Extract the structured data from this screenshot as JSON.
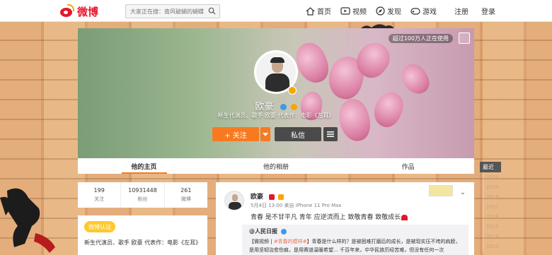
{
  "header": {
    "logo_text": "微博",
    "search_placeholder": "大家正在搜：南风破蝴的蝴蝶目...",
    "nav": [
      {
        "label": "首页",
        "icon": "home-icon"
      },
      {
        "label": "视频",
        "icon": "video-icon"
      },
      {
        "label": "发现",
        "icon": "discover-icon"
      },
      {
        "label": "游戏",
        "icon": "game-icon"
      }
    ],
    "register_label": "注册",
    "login_label": "登录"
  },
  "profile": {
    "cover_badge": "超过100万人正在使用",
    "name": "欧豪",
    "bio": "新生代演员、歌手 欧豪 代表作：电影《左耳》",
    "follow_label": "+ 关注",
    "message_label": "私信"
  },
  "tabs": [
    {
      "label": "他的主页",
      "active": true
    },
    {
      "label": "他的相册",
      "active": false
    },
    {
      "label": "作品",
      "active": false
    }
  ],
  "timeline": {
    "head": "最近",
    "years": [
      "2020",
      "2019",
      "2018",
      "2017",
      "2016",
      "2015",
      "2014",
      "2013"
    ]
  },
  "stats": [
    {
      "value": "199",
      "label": "关注"
    },
    {
      "value": "10931448",
      "label": "粉丝"
    },
    {
      "value": "261",
      "label": "微博"
    }
  ],
  "info": {
    "badge": "微博认证",
    "text": "新生代演员、歌手 欧豪 代表作：电影《左耳》"
  },
  "post": {
    "author": "欧豪",
    "meta": "5月4日 13:00 来自 iPhone 11 Pro Max",
    "text": "青春 是不甘平凡 青年 应逆流而上 致敬青春 致敬成长",
    "repost_author": "@人民日报",
    "repost_text_prefix": "【微视频 | ",
    "repost_tag": "#青春的模样#",
    "repost_text_suffix": "】青春是什么样的？是被困难打磨后的成长，是被现实压不垮的肩膀，是用坚韧治愈伤痕，是用赛道温暖希望… 千百年来，中华民族历经苦难，但没有任何一次"
  },
  "colors": {
    "brand_red": "#e6162d",
    "follow_orange": "#f77a21",
    "badge_yellow": "#ffc82c"
  }
}
